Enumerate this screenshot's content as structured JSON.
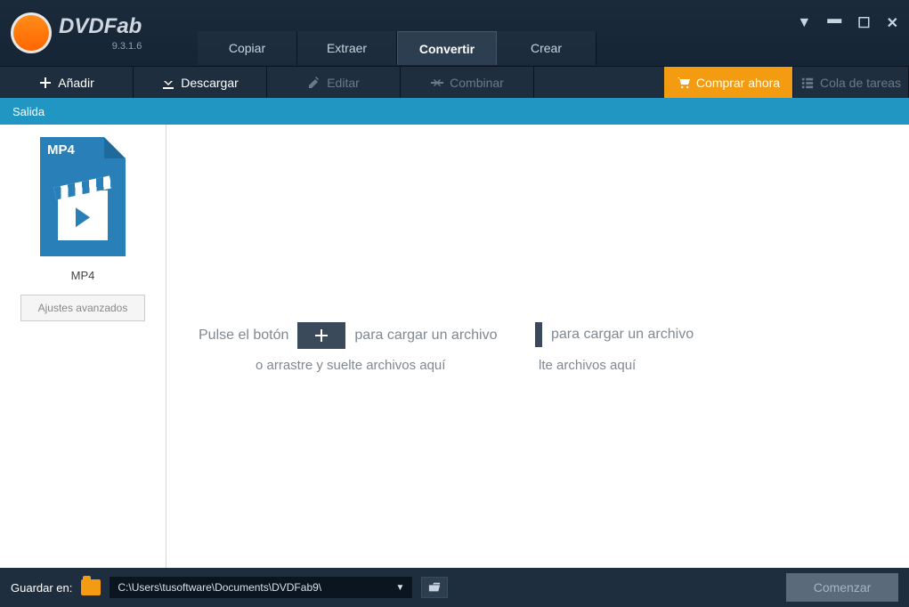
{
  "app": {
    "name": "DVDFab",
    "version": "9.3.1.6"
  },
  "tabs": {
    "copy": "Copiar",
    "extract": "Extraer",
    "convert": "Convertir",
    "create": "Crear"
  },
  "toolbar": {
    "add": "Añadir",
    "download": "Descargar",
    "edit": "Editar",
    "combine": "Combinar",
    "buy": "Comprar ahora",
    "queue": "Cola de tareas"
  },
  "output": {
    "label": "Salida"
  },
  "sidebar": {
    "format_badge": "MP4",
    "format_name": "MP4",
    "advanced": "Ajustes avanzados"
  },
  "dropzone": {
    "hint_prefix": "Pulse el botón",
    "hint_suffix": "para cargar un archivo",
    "sub1": "o arrastre y suelte archivos aquí",
    "hint2_suffix": "para cargar un archivo",
    "sub2": "lte archivos aquí"
  },
  "footer": {
    "save_label": "Guardar en:",
    "path": "C:\\Users\\tusoftware\\Documents\\DVDFab9\\",
    "start": "Comenzar"
  }
}
